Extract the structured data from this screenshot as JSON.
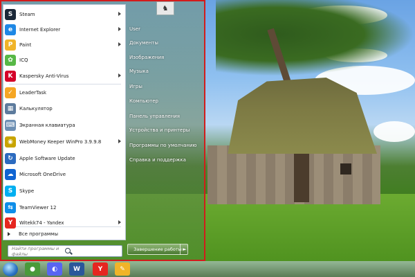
{
  "start_menu": {
    "programs": [
      {
        "label": "Steam",
        "icon": "steam-icon",
        "color": "#1b2838",
        "glyph": "S",
        "has_submenu": true
      },
      {
        "label": "Internet Explorer",
        "icon": "internet-explorer-icon",
        "color": "#1e88e5",
        "glyph": "e",
        "has_submenu": true
      },
      {
        "label": "Paint",
        "icon": "paint-icon",
        "color": "#f0b429",
        "glyph": "P",
        "has_submenu": true
      },
      {
        "label": "ICQ",
        "icon": "icq-icon",
        "color": "#57b846",
        "glyph": "✿",
        "has_submenu": false
      },
      {
        "label": "Kaspersky Anti-Virus",
        "icon": "kaspersky-icon",
        "color": "#d40029",
        "glyph": "K",
        "has_submenu": true
      },
      {
        "label": "LeaderTask",
        "icon": "leadertask-icon",
        "color": "#f5a623",
        "glyph": "✓",
        "has_submenu": false
      },
      {
        "label": "Калькулятор",
        "icon": "calculator-icon",
        "color": "#5d7b9d",
        "glyph": "▦",
        "has_submenu": false
      },
      {
        "label": "Экранная клавиатура",
        "icon": "keyboard-icon",
        "color": "#6d8fb3",
        "glyph": "⌨",
        "has_submenu": false
      },
      {
        "label": "WebMoney Keeper WinPro 3.9.9.8",
        "icon": "webmoney-icon",
        "color": "#c8a400",
        "glyph": "◉",
        "has_submenu": true
      },
      {
        "label": "Apple Software Update",
        "icon": "apple-update-icon",
        "color": "#2c6bbf",
        "glyph": "↻",
        "has_submenu": false
      },
      {
        "label": "Microsoft OneDrive",
        "icon": "onedrive-icon",
        "color": "#0f64d2",
        "glyph": "☁",
        "has_submenu": false
      },
      {
        "label": "Skype",
        "icon": "skype-icon",
        "color": "#00aff0",
        "glyph": "S",
        "has_submenu": false
      },
      {
        "label": "TeamViewer 12",
        "icon": "teamviewer-icon",
        "color": "#0e8ee9",
        "glyph": "⇆",
        "has_submenu": false
      },
      {
        "label": "Witekk74 - Yandex",
        "icon": "yandex-icon",
        "color": "#e52620",
        "glyph": "Y",
        "has_submenu": true
      }
    ],
    "all_programs": "Все программы",
    "search_placeholder": "Найти программы и файлы",
    "right_links": [
      "User",
      "Документы",
      "Изображения",
      "Музыка",
      "Игры",
      "Компьютер",
      "Панель управления",
      "Устройства и принтеры",
      "Программы по умолчанию",
      "Справка и поддержка"
    ],
    "shutdown_label": "Завершение работы",
    "shutdown_arrow": "►"
  },
  "taskbar": {
    "pinned": [
      {
        "icon": "chrome-icon",
        "color": "#4a9a3a",
        "glyph": "●"
      },
      {
        "icon": "discord-icon",
        "color": "#5865f2",
        "glyph": "◐"
      },
      {
        "icon": "word-icon",
        "color": "#2b579a",
        "glyph": "W"
      },
      {
        "icon": "yandex-browser-icon",
        "color": "#e52620",
        "glyph": "Y"
      },
      {
        "icon": "paint-icon",
        "color": "#f0b429",
        "glyph": "✎"
      }
    ]
  }
}
